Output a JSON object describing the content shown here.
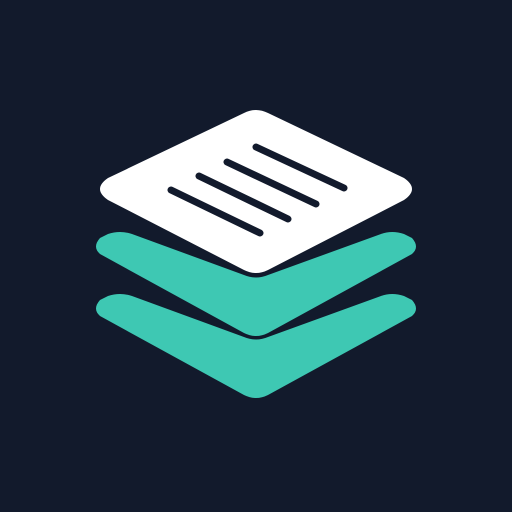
{
  "icon": {
    "name": "stacked-documents-logo",
    "background_color": "#121a2c",
    "paper_color": "#ffffff",
    "layer_color": "#3ec8b3",
    "line_color": "#121a2c",
    "text_line_count": 4
  }
}
